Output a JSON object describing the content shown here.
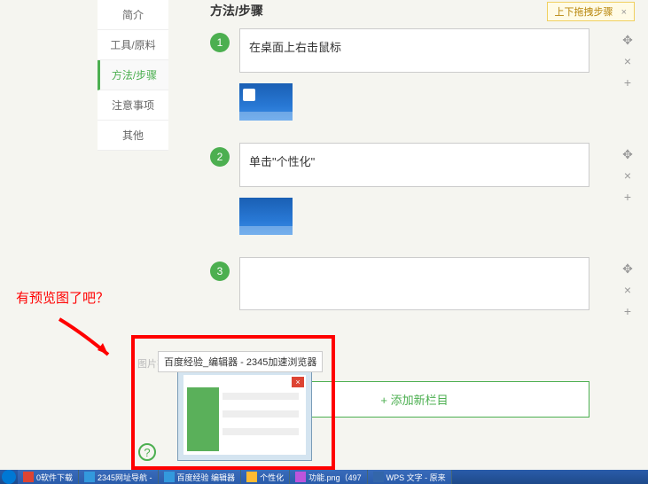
{
  "sidebar": {
    "items": [
      {
        "label": "简介"
      },
      {
        "label": "工具/原料"
      },
      {
        "label": "方法/步骤"
      },
      {
        "label": "注意事项"
      },
      {
        "label": "其他"
      }
    ]
  },
  "section_title": "方法/步骤",
  "tip_badge": {
    "text": "上下拖拽步骤",
    "close": "×"
  },
  "steps": [
    {
      "num": "1",
      "text": "在桌面上右击鼠标"
    },
    {
      "num": "2",
      "text": "单击\"个性化\""
    },
    {
      "num": "3",
      "text": ""
    }
  ],
  "controls": {
    "move": "✥",
    "remove": "×",
    "add": "+"
  },
  "img_hint": "图片有误",
  "add_section": "+  添加新栏目",
  "annotation": "有预览图了吧？",
  "preview_tip": "百度经验_编辑器 - 2345加速浏览器",
  "help": "?",
  "taskbar": {
    "items": [
      {
        "label": "0软件下载"
      },
      {
        "label": "2345网址导航 -"
      },
      {
        "label": "百度经验 编辑器"
      },
      {
        "label": "个性化"
      },
      {
        "label": "功能.png（497"
      },
      {
        "label": "WPS 文字 - 原来"
      }
    ]
  }
}
